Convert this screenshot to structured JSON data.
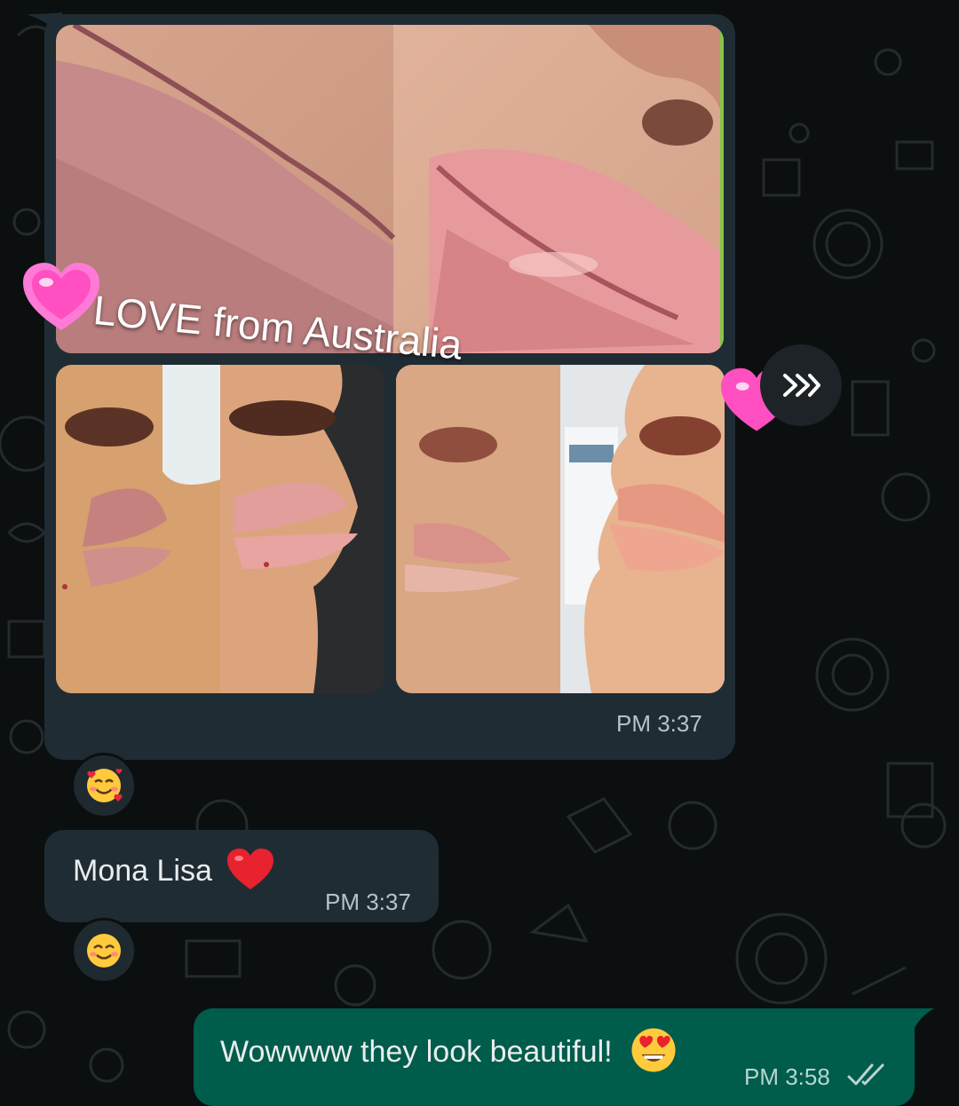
{
  "messages": [
    {
      "direction": "incoming",
      "type": "media",
      "overlay_text": "LOVE from Australia",
      "time": "PM 3:37",
      "reaction": "smiling-face-with-hearts"
    },
    {
      "direction": "incoming",
      "type": "text",
      "text": "Mona Lisa",
      "emoji": "red-heart",
      "time": "PM 3:37",
      "reaction": "smiling-face"
    },
    {
      "direction": "outgoing",
      "type": "text",
      "text": "Wowwww they look beautiful!",
      "emoji": "heart-eyes",
      "time": "PM 3:58",
      "status": "read-double-check"
    }
  ],
  "colors": {
    "background": "#0b0f10",
    "incoming_bubble": "#202c33",
    "outgoing_bubble": "#005c4b",
    "read_ticks": "#b6d6cf"
  }
}
